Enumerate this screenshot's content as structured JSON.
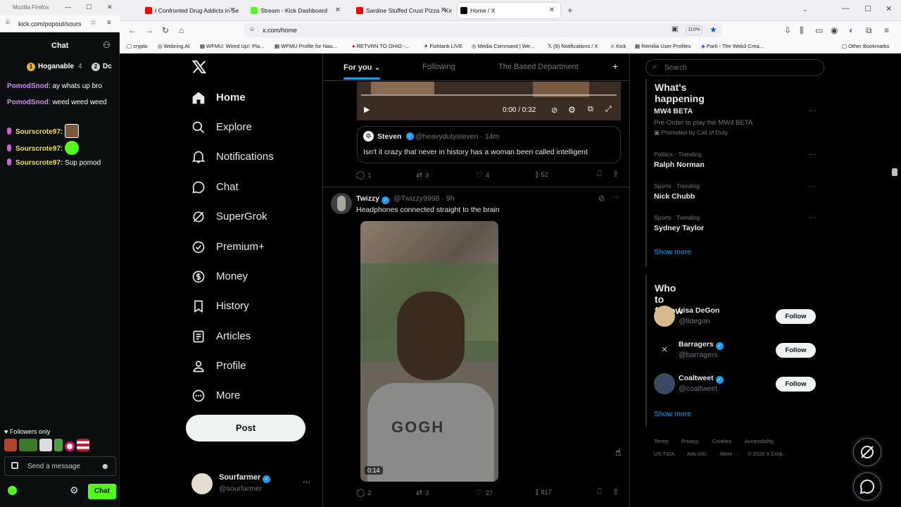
{
  "kick": {
    "window_title": "Mozilla Firefox",
    "url": "kick.com/popout/sours",
    "chat_title": "Chat",
    "pinned": [
      {
        "name": "Hoganable",
        "count": "4"
      },
      {
        "name": "Dc"
      }
    ],
    "messages": [
      {
        "user": "PomodSnod",
        "text": " ay whats up bro"
      },
      {
        "user": "PomodSnod",
        "text": " weed weed weed"
      },
      {
        "user": "Sourscrote97:",
        "text": ""
      },
      {
        "user": "Sourscrote97:",
        "text": ""
      },
      {
        "user": "Sourscrote97:",
        "text": " Sup pomod"
      }
    ],
    "followers_only": "Followers only",
    "input_placeholder": "Send a message",
    "chat_button": "Chat"
  },
  "browser": {
    "tabs": [
      {
        "label": "I Confronted Drug Addicts in Se",
        "color": "#ff0000"
      },
      {
        "label": "Stream - Kick Dashboard",
        "color": "#53fc18"
      },
      {
        "label": "Sardine Stuffed Crust Pizza - Kir",
        "color": "#ff0000"
      },
      {
        "label": "Home / X",
        "color": "#000000"
      }
    ],
    "url": "x.com/home",
    "zoom": "110%",
    "bookmarks": [
      "crypto",
      "Webring.AI",
      "WFMU: Wired Up!: Pla...",
      "WFMU Profile for Nau...",
      "RETVRN TO OHIO -...",
      "Fishtank LIVE",
      "Media Command | We...",
      "(9) Notifications / X",
      "Kick",
      "Remilia User Profiles",
      "Parti - The Web3 Crea...",
      "Other Bookmarks"
    ]
  },
  "x": {
    "nav": [
      {
        "label": "Home",
        "icon": "home-icon"
      },
      {
        "label": "Explore",
        "icon": "search-icon"
      },
      {
        "label": "Notifications",
        "icon": "bell-icon"
      },
      {
        "label": "Chat",
        "icon": "chat-icon"
      },
      {
        "label": "SuperGrok",
        "icon": "grok-icon"
      },
      {
        "label": "Premium+",
        "icon": "premium-icon"
      },
      {
        "label": "Money",
        "icon": "money-icon"
      },
      {
        "label": "History",
        "icon": "bookmark-icon"
      },
      {
        "label": "Articles",
        "icon": "articles-icon"
      },
      {
        "label": "Profile",
        "icon": "person-icon"
      },
      {
        "label": "More",
        "icon": "more-circle-icon"
      }
    ],
    "post_button": "Post",
    "account": {
      "name": "Sourfarmer",
      "handle": "@sourfarmer",
      "more": "···"
    },
    "feed_tabs": {
      "for_you": "For you ⌄",
      "following": "Following",
      "based": "The Based Department",
      "plus": "+"
    },
    "post1": {
      "video_time": "0:00 / 0:32",
      "quote": {
        "name": "Steven",
        "handle": "@heavydutysteven · 14m",
        "text": "Isn't it crazy that never in history has a woman been called intelligent"
      },
      "actions": {
        "replies": "1",
        "reposts": "3",
        "likes": "4",
        "views": "52"
      }
    },
    "post2": {
      "name": "Twizzy",
      "handle": "@Twizzy9998 · 9h",
      "text": "Headphones connected straight to the brain",
      "video_duration": "0:14",
      "actions": {
        "replies": "2",
        "reposts": "3",
        "likes": "27",
        "views": "817"
      }
    },
    "search_placeholder": "Search",
    "happening": {
      "title": "What's happening",
      "items": [
        {
          "category": "",
          "name": "MW4 BETA",
          "sub": "Pre-Order to play the MW4 BETA",
          "promo": "Promoted by Call of Duty"
        },
        {
          "category": "Politics · Trending",
          "name": "Ralph Norman"
        },
        {
          "category": "Sports · Trending",
          "name": "Nick Chubb"
        },
        {
          "category": "Sports · Trending",
          "name": "Sydney Taylor"
        }
      ],
      "show_more": "Show more"
    },
    "who_to_follow": {
      "title": "Who to follow",
      "items": [
        {
          "name": "Lisa DeGon",
          "handle": "@lldegon",
          "button": "Follow",
          "verified": false
        },
        {
          "name": "Barragers",
          "handle": "@barragers",
          "button": "Follow",
          "verified": true
        },
        {
          "name": "Coaltweet",
          "handle": "@coaltweet",
          "button": "Follow",
          "verified": true
        }
      ],
      "show_more": "Show more"
    },
    "footer": [
      "Terms",
      "Privacy",
      "Cookies",
      "Accessibility",
      "US TIDA",
      "Ads info",
      "More ···",
      "© 2026 X Corp."
    ]
  },
  "colors": {
    "accent": "#1d9bf0",
    "kick_green": "#53fc18",
    "bg": "#000000",
    "border": "#2f3336"
  }
}
